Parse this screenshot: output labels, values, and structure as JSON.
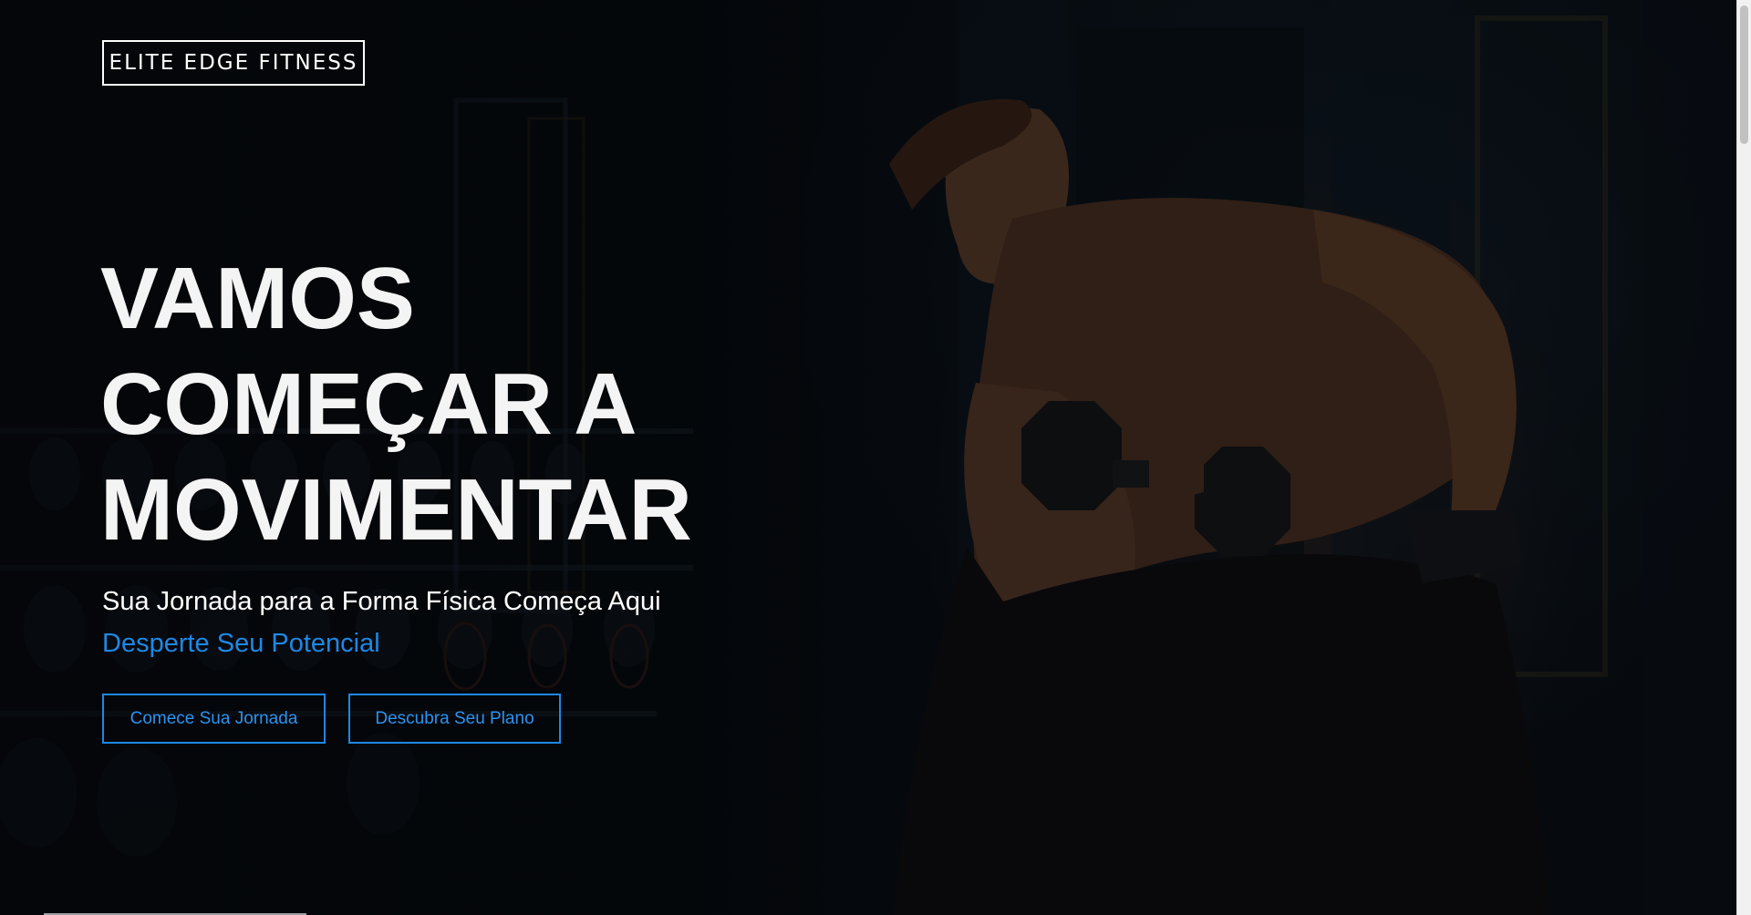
{
  "header": {
    "logo_text": "ELITE EDGE FITNESS"
  },
  "hero": {
    "title_lines": [
      "VAMOS",
      "COMEÇAR A",
      "MOVIMENTAR"
    ],
    "subtitle": "Sua Jornada para a Forma Física Começa Aqui",
    "tagline": "Desperte Seu Potencial",
    "buttons": {
      "start_label": "Comece Sua Jornada",
      "plan_label": "Descubra Seu Plano"
    },
    "background_image": "man-lifting-dumbbell-in-dark-gym"
  },
  "colors": {
    "accent": "#1e88e5",
    "text": "#ffffff",
    "background": "#05080c"
  }
}
